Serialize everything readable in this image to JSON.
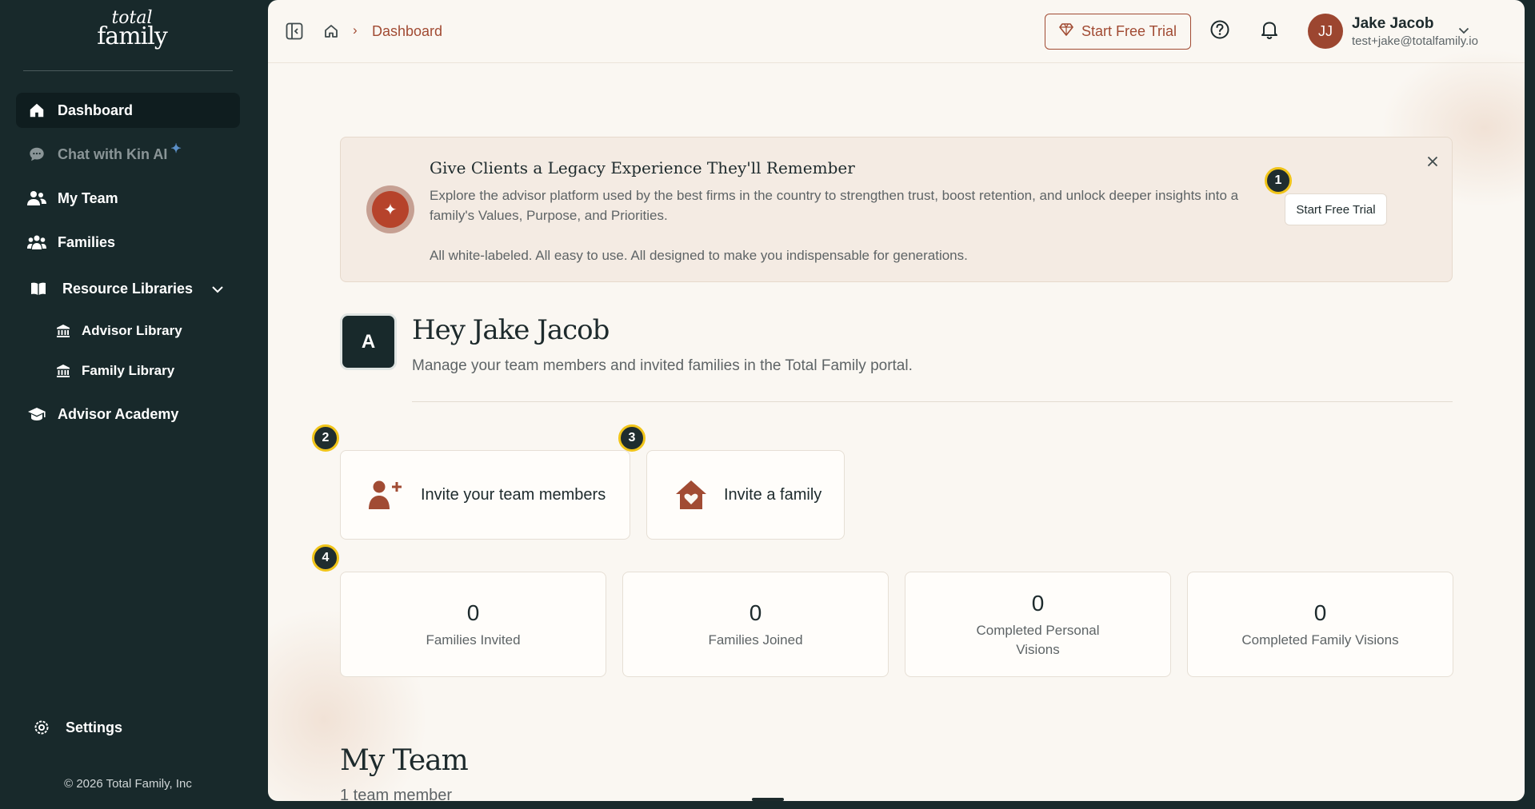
{
  "brand": {
    "logo_line1": "total",
    "logo_line2": "family"
  },
  "sidebar": {
    "items": [
      {
        "label": "Dashboard",
        "icon": "home-icon"
      },
      {
        "label": "Chat with Kin AI",
        "icon": "chat-icon"
      },
      {
        "label": "My Team",
        "icon": "team-icon"
      },
      {
        "label": "Families",
        "icon": "families-icon"
      },
      {
        "label": "Resource Libraries",
        "icon": "book-icon"
      },
      {
        "label": "Advisor Library",
        "icon": "library-icon"
      },
      {
        "label": "Family Library",
        "icon": "library-icon"
      },
      {
        "label": "Advisor Academy",
        "icon": "graduation-cap-icon"
      }
    ],
    "settings_label": "Settings",
    "copyright": "© 2026 Total Family, Inc"
  },
  "topbar": {
    "breadcrumb": "Dashboard",
    "trial_label": "Start Free Trial",
    "user_initials": "JJ",
    "user_name": "Jake Jacob",
    "user_email": "test+jake@totalfamily.io"
  },
  "banner": {
    "title": "Give Clients a Legacy Experience They'll Remember",
    "text": "Explore the advisor platform used by the best firms in the country to strengthen trust, boost retention, and unlock deeper insights into a family's Values, Purpose, and Priorities.",
    "text2": "All white-labeled. All easy to use. All designed to make you indispensable for generations.",
    "button_label": "Start Free Trial"
  },
  "markers": [
    "1",
    "2",
    "3",
    "4"
  ],
  "greeting": {
    "avatar_letter": "A",
    "title": "Hey Jake Jacob",
    "subtitle": "Manage your team members and invited families in the Total Family portal."
  },
  "actions": [
    {
      "label": "Invite your team members",
      "icon": "add-user-icon"
    },
    {
      "label": "Invite a family",
      "icon": "house-heart-icon"
    }
  ],
  "stats": [
    {
      "value": "0",
      "label": "Families Invited"
    },
    {
      "value": "0",
      "label": "Families Joined"
    },
    {
      "value": "0",
      "label": "Completed Personal Visions"
    },
    {
      "value": "0",
      "label": "Completed Family Visions"
    }
  ],
  "team_section": {
    "title": "My Team",
    "subtitle": "1 team member"
  },
  "colors": {
    "sidebar": "#18292b",
    "accent": "#a14b33",
    "background": "#faf7f2",
    "marker_ring": "#f0c419"
  }
}
